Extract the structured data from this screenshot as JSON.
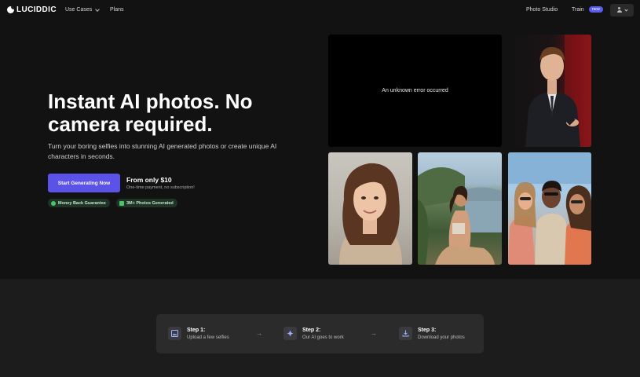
{
  "nav": {
    "brand": "LUCIDDIC",
    "use_cases": "Use Cases",
    "plans": "Plans",
    "photo_studio": "Photo Studio",
    "train": "Train",
    "train_badge": "new"
  },
  "hero": {
    "title": "Instant AI photos. No camera required.",
    "subtitle": "Turn your boring selfies into stunning AI generated photos or create unique AI characters in seconds.",
    "cta_label": "Start Generating Now",
    "price": "From only $10",
    "price_note": "One-time payment, no subscription!",
    "badges": [
      "Money Back Guarantee",
      "3M+ Photos Generated"
    ]
  },
  "gallery": {
    "error_message": "An unknown error occurred"
  },
  "steps": [
    {
      "title": "Step 1:",
      "desc": "Upload a few selfies",
      "icon": "image-icon"
    },
    {
      "title": "Step 2:",
      "desc": "Our AI goes to work",
      "icon": "sparkle-icon"
    },
    {
      "title": "Step 3:",
      "desc": "Download your photos",
      "icon": "download-icon"
    }
  ],
  "step_arrow": "→",
  "colors": {
    "accent": "#5b52e8",
    "badge_green": "#4cc36a",
    "background": "#121212"
  }
}
